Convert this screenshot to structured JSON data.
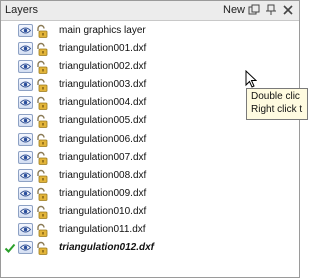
{
  "panel": {
    "title": "Layers",
    "new_label": "New",
    "toolbar_icons": [
      "float-window-icon",
      "pin-icon",
      "close-icon"
    ]
  },
  "layers": [
    {
      "name": "main graphics layer",
      "active": false,
      "visible": true
    },
    {
      "name": "triangulation001.dxf",
      "active": false,
      "visible": true
    },
    {
      "name": "triangulation002.dxf",
      "active": false,
      "visible": true
    },
    {
      "name": "triangulation003.dxf",
      "active": false,
      "visible": true
    },
    {
      "name": "triangulation004.dxf",
      "active": false,
      "visible": true
    },
    {
      "name": "triangulation005.dxf",
      "active": false,
      "visible": true
    },
    {
      "name": "triangulation006.dxf",
      "active": false,
      "visible": true
    },
    {
      "name": "triangulation007.dxf",
      "active": false,
      "visible": true
    },
    {
      "name": "triangulation008.dxf",
      "active": false,
      "visible": true
    },
    {
      "name": "triangulation009.dxf",
      "active": false,
      "visible": true
    },
    {
      "name": "triangulation010.dxf",
      "active": false,
      "visible": true
    },
    {
      "name": "triangulation011.dxf",
      "active": false,
      "visible": true
    },
    {
      "name": "triangulation012.dxf",
      "active": true,
      "visible": true
    }
  ],
  "tooltip": {
    "line1": "Double clic",
    "line2": "Right click t"
  },
  "colors": {
    "active_check": "#2aa02a",
    "tooltip_bg": "#fffbe0",
    "lock_gold": "#e3b53a"
  }
}
